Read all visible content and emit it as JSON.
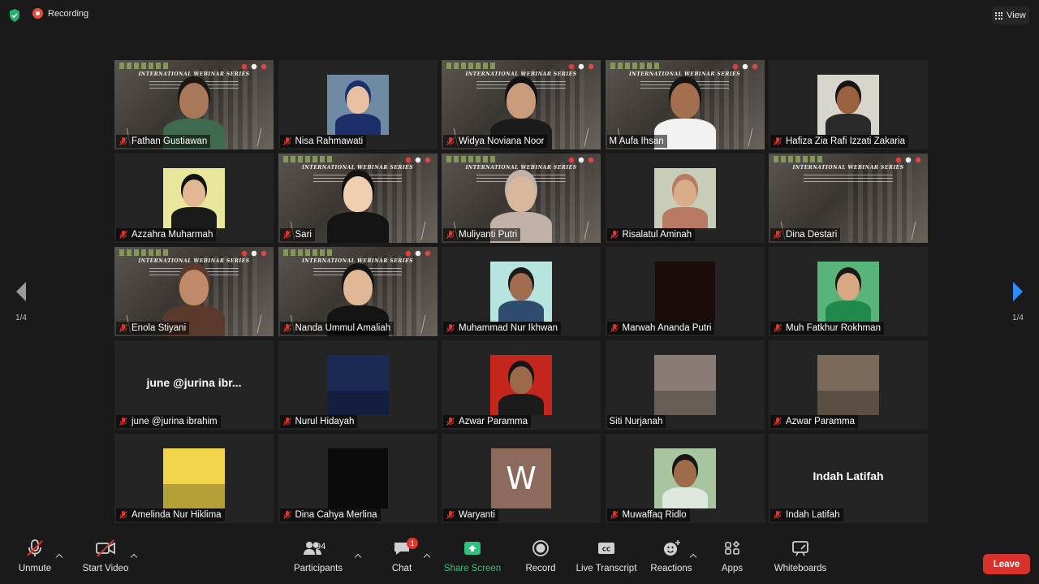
{
  "topbar": {
    "recording_label": "Recording",
    "view_label": "View"
  },
  "pagination": {
    "left_label": "1/4",
    "right_label": "1/4"
  },
  "slide": {
    "title": "INTERNATIONAL WEBINAR SERIES"
  },
  "participants": [
    {
      "name": "Fathan Gustiawan",
      "muted": true,
      "video": "slide-person"
    },
    {
      "name": "Nisa Rahmawati",
      "muted": true,
      "video": "photo"
    },
    {
      "name": "Widya Noviana Noor",
      "muted": true,
      "video": "slide-person"
    },
    {
      "name": "M Aufa Ihsan",
      "muted": false,
      "video": "slide-person",
      "active_speaker": true
    },
    {
      "name": "Hafiza Zia Rafi Izzati Zakaria",
      "muted": true,
      "video": "photo"
    },
    {
      "name": "Azzahra Muharmah",
      "muted": true,
      "video": "photo"
    },
    {
      "name": "Sari",
      "muted": true,
      "video": "slide-person"
    },
    {
      "name": "Muliyanti Putri",
      "muted": true,
      "video": "slide-person"
    },
    {
      "name": "Risalatul Aminah",
      "muted": true,
      "video": "photo"
    },
    {
      "name": "Dina Destari",
      "muted": true,
      "video": "slide"
    },
    {
      "name": "Enola Stiyani",
      "muted": true,
      "video": "slide-person"
    },
    {
      "name": "Nanda Ummul Amaliah",
      "muted": true,
      "video": "slide-person"
    },
    {
      "name": "Muhammad Nur Ikhwan",
      "muted": true,
      "video": "photo"
    },
    {
      "name": "Marwah Ananda Putri",
      "muted": true,
      "video": "dark"
    },
    {
      "name": "Muh Fatkhur Rokhman",
      "muted": true,
      "video": "photo"
    },
    {
      "name": "june @jurina ibrahim",
      "muted": true,
      "video": "name",
      "display": "june @jurina ibr..."
    },
    {
      "name": "Nurul Hidayah",
      "muted": true,
      "video": "photo"
    },
    {
      "name": "Azwar Paramma",
      "muted": true,
      "video": "photo"
    },
    {
      "name": "Siti Nurjanah",
      "muted": false,
      "video": "photo"
    },
    {
      "name": "Azwar Paramma",
      "muted": true,
      "video": "photo"
    },
    {
      "name": "Amelinda Nur Hiklima",
      "muted": true,
      "video": "photo"
    },
    {
      "name": "Dina Cahya Merlina",
      "muted": true,
      "video": "dark"
    },
    {
      "name": "Waryanti",
      "muted": true,
      "video": "avatar-letter",
      "letter": "W"
    },
    {
      "name": "Muwaffaq Ridlo",
      "muted": true,
      "video": "photo"
    },
    {
      "name": "Indah Latifah",
      "muted": true,
      "video": "name",
      "display": "Indah Latifah"
    }
  ],
  "toolbar": {
    "unmute_label": "Unmute",
    "start_video_label": "Start Video",
    "participants_label": "Participants",
    "participants_count": "94",
    "chat_label": "Chat",
    "chat_badge": "1",
    "share_screen_label": "Share Screen",
    "record_label": "Record",
    "live_transcript_label": "Live Transcript",
    "cc_label": "CC",
    "reactions_label": "Reactions",
    "apps_label": "Apps",
    "whiteboards_label": "Whiteboards",
    "leave_label": "Leave"
  },
  "colors": {
    "accent_green": "#2ec27e",
    "leave_red": "#d9312b",
    "active_speaker": "#c9e264",
    "muted_icon": "#e0342c"
  }
}
